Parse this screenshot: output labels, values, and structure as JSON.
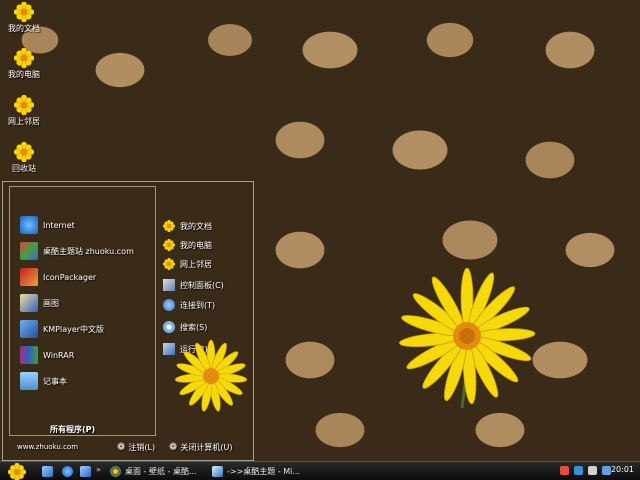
{
  "desktop": {
    "icons": [
      {
        "label": "我的文档",
        "icon": "flower-icon"
      },
      {
        "label": "我的电脑",
        "icon": "flower-icon"
      },
      {
        "label": "网上邻居",
        "icon": "flower-icon"
      },
      {
        "label": "回收站",
        "icon": "flower-icon"
      }
    ]
  },
  "start_menu": {
    "left_items": [
      {
        "label": "Internet",
        "icon": "ie-icon"
      },
      {
        "label": "桌酷主题站 zhuoku.com",
        "icon": "site-icon"
      },
      {
        "label": "IconPackager",
        "icon": "iconpackager-icon"
      },
      {
        "label": "画图",
        "icon": "paint-icon"
      },
      {
        "label": "KMPlayer中文版",
        "icon": "kmplayer-icon"
      },
      {
        "label": "WinRAR",
        "icon": "winrar-icon"
      },
      {
        "label": "记事本",
        "icon": "notepad-icon"
      }
    ],
    "all_programs": "所有程序(P)",
    "right_items": [
      {
        "label": "我的文档",
        "icon": "flower-icon"
      },
      {
        "label": "我的电脑",
        "icon": "flower-icon"
      },
      {
        "label": "网上邻居",
        "icon": "flower-icon"
      },
      {
        "label": "控制面板(C)",
        "icon": "control-panel-icon"
      },
      {
        "label": "连接到(T)",
        "icon": "connect-icon"
      },
      {
        "label": "搜索(S)",
        "icon": "search-icon"
      },
      {
        "label": "运行(R)...",
        "icon": "run-icon"
      }
    ],
    "site": "www.zhuoku.com",
    "logoff": "注销(L)",
    "shutdown": "关闭计算机(U)"
  },
  "taskbar": {
    "tasks": [
      {
        "label": "桌面 - 壁纸 - 桌酷...",
        "icon": "browser-icon"
      },
      {
        "label": "->>桌酷主题 - Mi...",
        "icon": "document-icon"
      }
    ],
    "clock": "20:01"
  },
  "colors": {
    "taskbar": "#111111",
    "petal": "#f5d90a",
    "center": "#e08a10"
  }
}
